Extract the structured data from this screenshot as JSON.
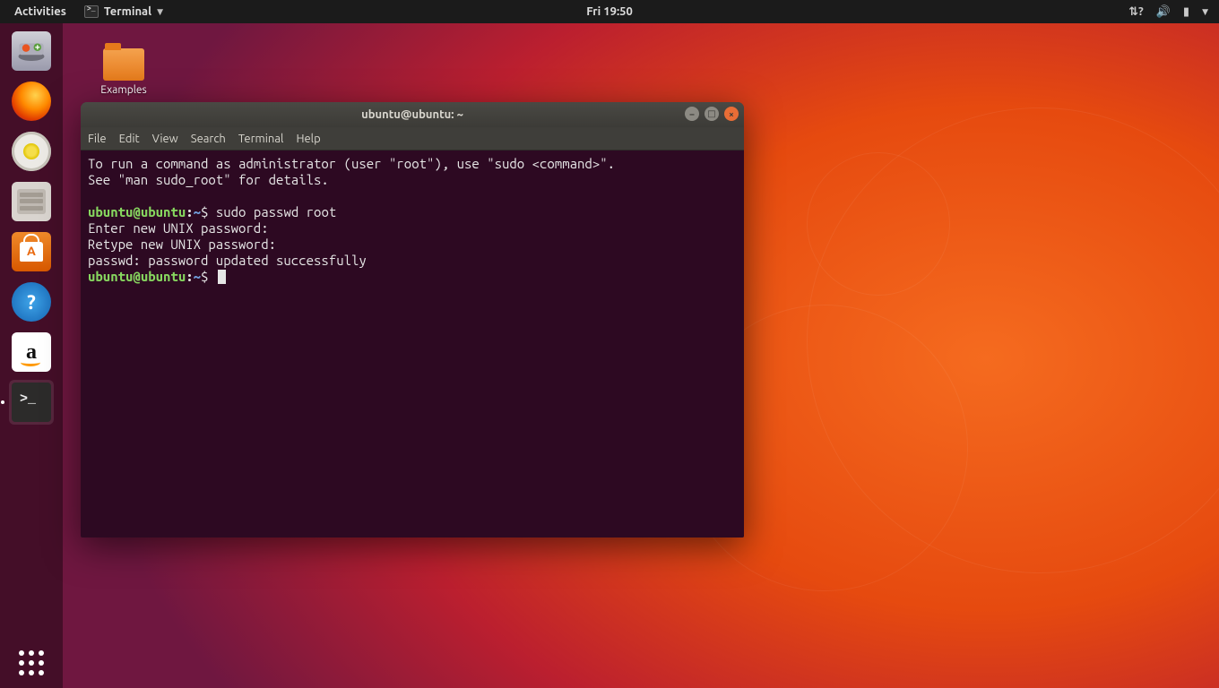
{
  "topbar": {
    "activities": "Activities",
    "app_name": "Terminal",
    "clock": "Fri 19:50",
    "status_icons": {
      "network": "network-icon",
      "volume": "volume-icon",
      "battery": "battery-icon",
      "arrow": "system-menu-arrow-icon"
    }
  },
  "desktop": {
    "examples_label": "Examples"
  },
  "dock": {
    "items": [
      {
        "name": "install-ubuntu-icon"
      },
      {
        "name": "firefox-icon"
      },
      {
        "name": "rhythmbox-icon"
      },
      {
        "name": "files-icon"
      },
      {
        "name": "ubuntu-software-icon"
      },
      {
        "name": "help-icon"
      },
      {
        "name": "amazon-icon"
      },
      {
        "name": "terminal-icon"
      }
    ],
    "show_apps": "show-applications-icon"
  },
  "window": {
    "title": "ubuntu@ubuntu: ~",
    "menu": {
      "file": "File",
      "edit": "Edit",
      "view": "View",
      "search": "Search",
      "terminal": "Terminal",
      "help": "Help"
    },
    "controls": {
      "min": "–",
      "max": "□",
      "close": "×"
    }
  },
  "terminal": {
    "motd_line1": "To run a command as administrator (user \"root\"), use \"sudo <command>\".",
    "motd_line2": "See \"man sudo_root\" for details.",
    "prompt_user": "ubuntu",
    "prompt_at": "@",
    "prompt_host": "ubuntu",
    "prompt_colon": ":",
    "prompt_path": "~",
    "prompt_symbol": "$",
    "cmd1": " sudo passwd root",
    "out1": "Enter new UNIX password: ",
    "out2": "Retype new UNIX password: ",
    "out3": "passwd: password updated successfully",
    "cmd2": " "
  },
  "colors": {
    "terminal_bg": "#2d0922",
    "prompt_user_color": "#87d75f",
    "prompt_path_color": "#6f9bd8",
    "close_btn": "#e86d36"
  }
}
